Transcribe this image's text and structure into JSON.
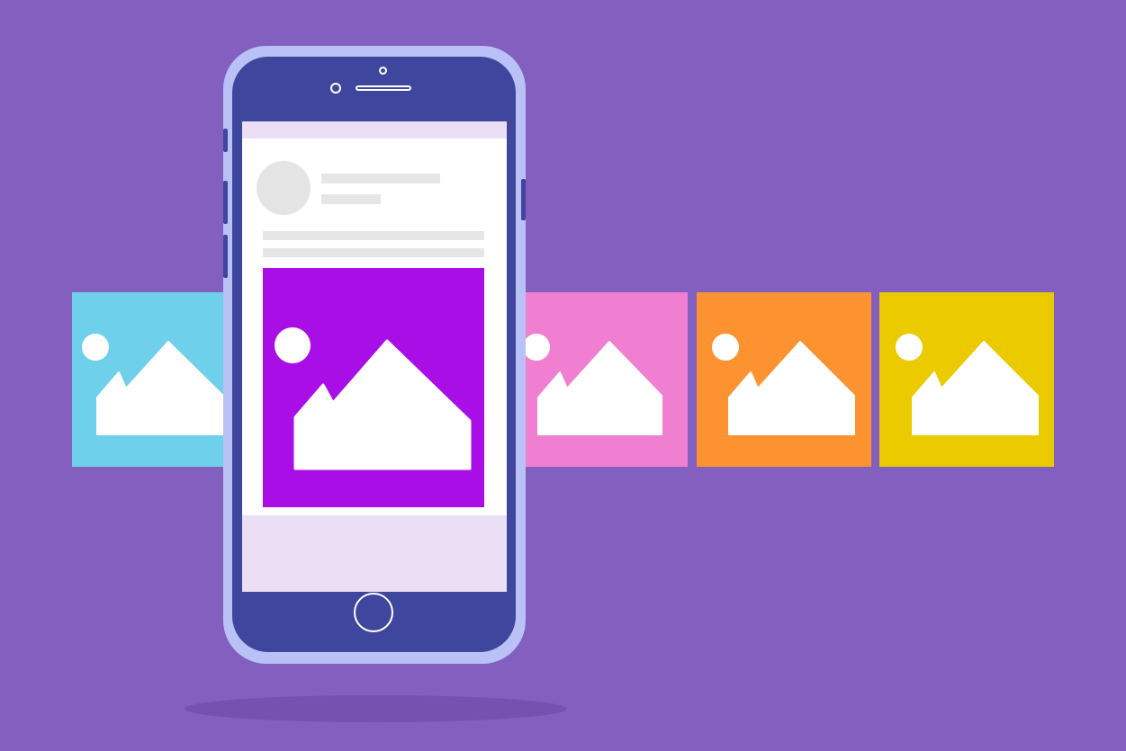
{
  "colors": {
    "background": "#835fc0",
    "phone_bezel": "#b9c1f7",
    "phone_body": "#3f469e",
    "screen": "#ebdff6",
    "active_image": "#a90ee6"
  },
  "carousel": {
    "tiles": [
      {
        "color": "#6fd0eb",
        "icon": "image-icon"
      },
      {
        "color": "#f07fd1",
        "icon": "image-icon"
      },
      {
        "color": "#fd9330",
        "icon": "image-icon"
      },
      {
        "color": "#ebcb00",
        "icon": "image-icon"
      }
    ]
  },
  "phone": {
    "post": {
      "avatar_icon": "avatar-placeholder",
      "image_icon": "image-icon"
    }
  }
}
